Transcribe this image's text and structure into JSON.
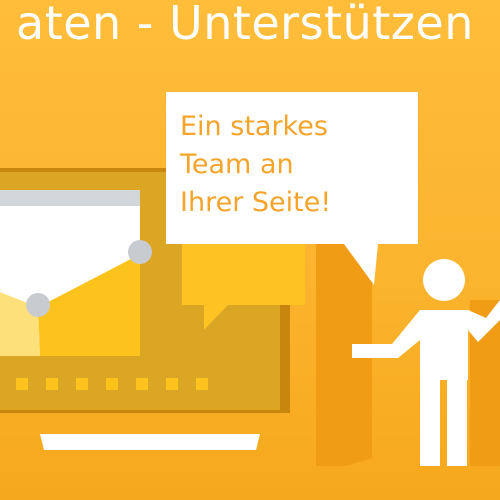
{
  "header": {
    "title": "aten - Unterstützen"
  },
  "speech_bubble": {
    "lines": [
      "Ein starkes",
      "Team an",
      "Ihrer Seite!"
    ]
  },
  "illustration": {
    "icon": "monitor-with-chart-icon",
    "figure": "presenter-person-icon"
  },
  "colors": {
    "background": "#fbb42e",
    "bubble": "#ffffff",
    "bubble_text": "#f5a42a",
    "monitor_frame": "#d9a322",
    "chart_light": "#fde07a",
    "chart_mid": "#fcc31c",
    "chart_node": "#c8ccd0"
  }
}
